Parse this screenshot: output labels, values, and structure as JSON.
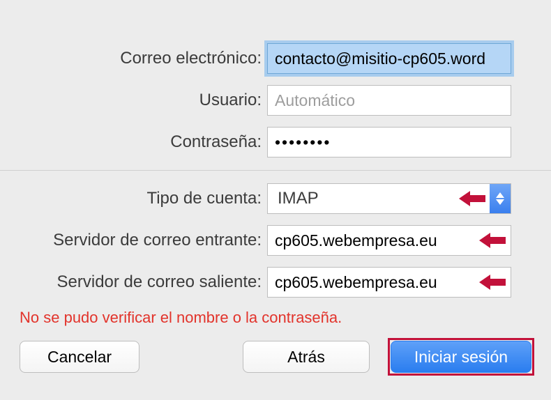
{
  "labels": {
    "email": "Correo electrónico:",
    "user": "Usuario:",
    "password": "Contraseña:",
    "account_type": "Tipo de cuenta:",
    "incoming": "Servidor de correo entrante:",
    "outgoing": "Servidor de correo saliente:"
  },
  "fields": {
    "email_value": "contacto@misitio-cp605.word",
    "user_placeholder": "Automático",
    "user_value": "",
    "password_value": "••••••••",
    "account_type_value": "IMAP",
    "incoming_value": "cp605.webempresa.eu",
    "outgoing_value": "cp605.webempresa.eu"
  },
  "error": "No se pudo verificar el nombre o la contraseña.",
  "buttons": {
    "cancel": "Cancelar",
    "back": "Atrás",
    "signin": "Iniciar sesión"
  },
  "annotations": {
    "arrow_color": "#c2113a"
  }
}
